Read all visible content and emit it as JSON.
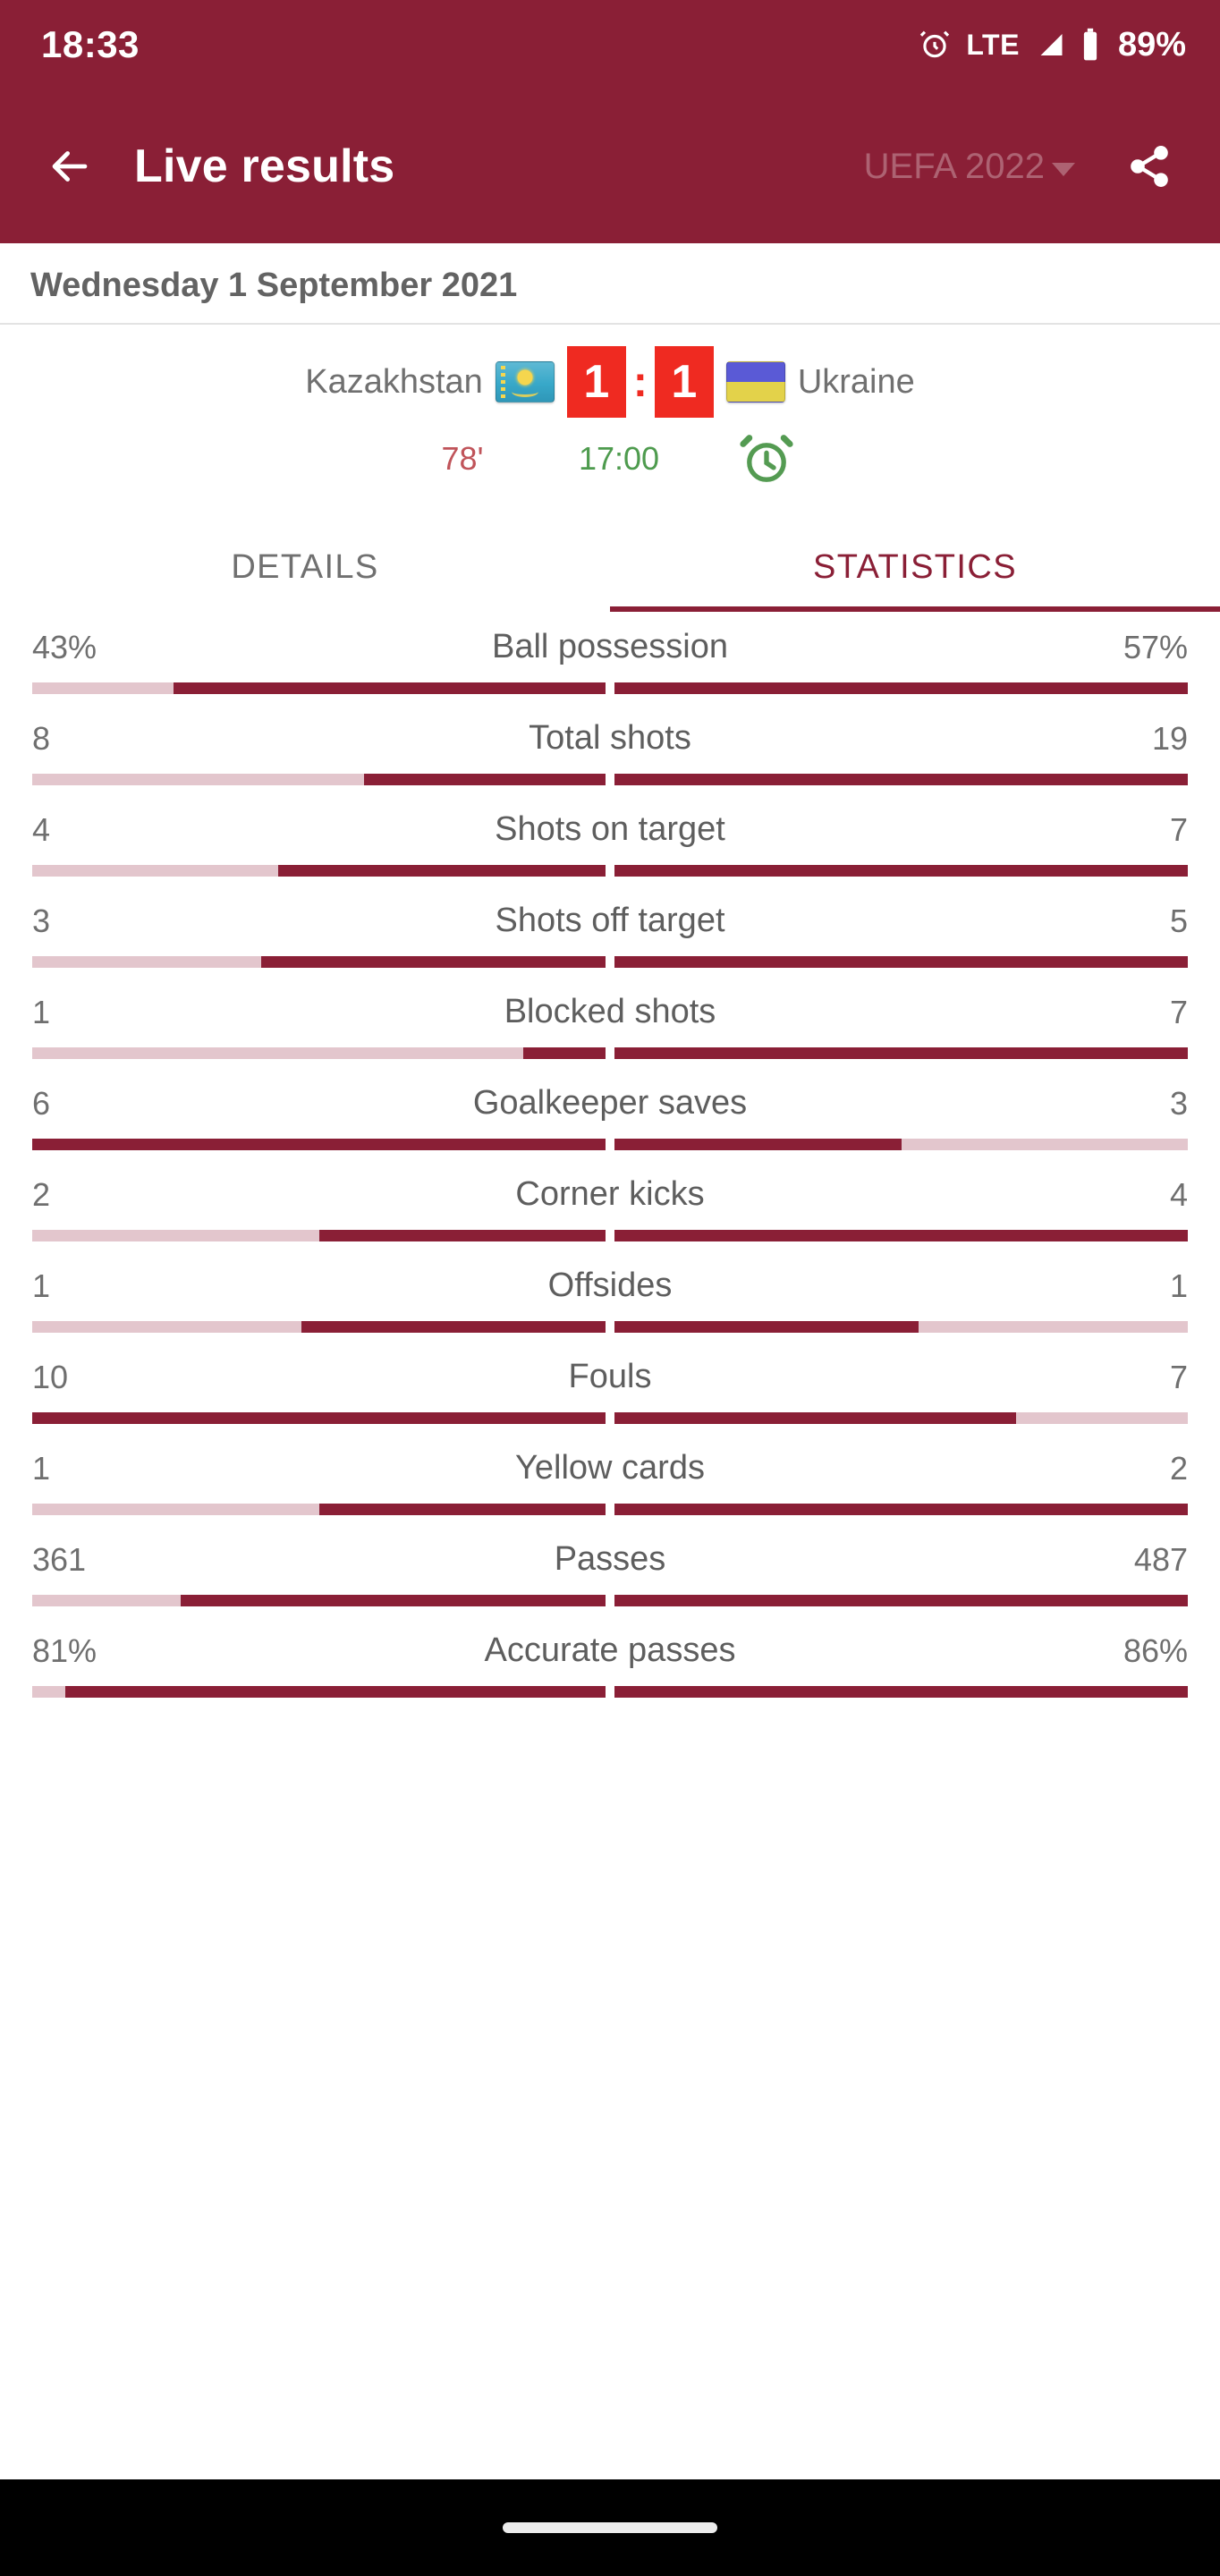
{
  "statusbar": {
    "time": "18:33",
    "network": "LTE",
    "battery": "89%",
    "alarm_icon": "alarm-clock-icon",
    "signal_icon": "signal-bars-icon",
    "battery_icon": "battery-icon"
  },
  "appbar": {
    "back_icon": "back-arrow-icon",
    "title": "Live results",
    "season": "UEFA 2022",
    "share_icon": "share-icon"
  },
  "date_header": "Wednesday 1 September 2021",
  "match": {
    "home_team": "Kazakhstan",
    "away_team": "Ukraine",
    "home_score": "1",
    "away_score": "1",
    "separator": ":",
    "minute": "78'",
    "kickoff": "17:00",
    "alarm_icon": "alarm-reminder-icon"
  },
  "tabs": [
    {
      "label": "DETAILS",
      "active": false
    },
    {
      "label": "STATISTICS",
      "active": true
    }
  ],
  "colors": {
    "brand": "#8a1f36",
    "score_badge": "#ef2a21",
    "bar_fill": "#8a1f36",
    "bar_track": "#e3c6cd",
    "minute": "#c0545a",
    "kickoff": "#4e9b4e"
  },
  "chart_data": {
    "type": "bar",
    "title": "Match statistics",
    "categories": [
      "Ball possession",
      "Total shots",
      "Shots on target",
      "Shots off target",
      "Blocked shots",
      "Goalkeeper saves",
      "Corner kicks",
      "Offsides",
      "Fouls",
      "Yellow cards",
      "Passes",
      "Accurate passes"
    ],
    "series": [
      {
        "name": "Kazakhstan",
        "values": [
          43,
          8,
          4,
          3,
          1,
          6,
          2,
          1,
          10,
          1,
          361,
          81
        ]
      },
      {
        "name": "Ukraine",
        "values": [
          57,
          19,
          7,
          5,
          7,
          3,
          4,
          1,
          7,
          2,
          487,
          86
        ]
      }
    ],
    "display_values": [
      {
        "left": "43%",
        "right": "57%"
      },
      {
        "left": "8",
        "right": "19"
      },
      {
        "left": "4",
        "right": "7"
      },
      {
        "left": "3",
        "right": "5"
      },
      {
        "left": "1",
        "right": "7"
      },
      {
        "left": "6",
        "right": "3"
      },
      {
        "left": "2",
        "right": "4"
      },
      {
        "left": "1",
        "right": "1"
      },
      {
        "left": "10",
        "right": "7"
      },
      {
        "left": "1",
        "right": "2"
      },
      {
        "left": "361",
        "right": "487"
      },
      {
        "left": "81%",
        "right": "86%"
      }
    ],
    "legend": [
      "Kazakhstan",
      "Ukraine"
    ],
    "legend_position": "none",
    "grid": false,
    "normalization": "each row scaled to max(left,right)"
  },
  "stats": [
    {
      "label": "Ball possession",
      "left": "43%",
      "right": "57%",
      "left_pct": 75.4,
      "right_pct": 100
    },
    {
      "label": "Total shots",
      "left": "8",
      "right": "19",
      "left_pct": 42.1,
      "right_pct": 100
    },
    {
      "label": "Shots on target",
      "left": "4",
      "right": "7",
      "left_pct": 57.1,
      "right_pct": 100
    },
    {
      "label": "Shots off target",
      "left": "3",
      "right": "5",
      "left_pct": 60.0,
      "right_pct": 100
    },
    {
      "label": "Blocked shots",
      "left": "1",
      "right": "7",
      "left_pct": 14.3,
      "right_pct": 100
    },
    {
      "label": "Goalkeeper saves",
      "left": "6",
      "right": "3",
      "left_pct": 100,
      "right_pct": 50.0
    },
    {
      "label": "Corner kicks",
      "left": "2",
      "right": "4",
      "left_pct": 50.0,
      "right_pct": 100
    },
    {
      "label": "Offsides",
      "left": "1",
      "right": "1",
      "left_pct": 53.0,
      "right_pct": 53.0
    },
    {
      "label": "Fouls",
      "left": "10",
      "right": "7",
      "left_pct": 100,
      "right_pct": 70.0
    },
    {
      "label": "Yellow cards",
      "left": "1",
      "right": "2",
      "left_pct": 50.0,
      "right_pct": 100
    },
    {
      "label": "Passes",
      "left": "361",
      "right": "487",
      "left_pct": 74.1,
      "right_pct": 100
    },
    {
      "label": "Accurate passes",
      "left": "81%",
      "right": "86%",
      "left_pct": 94.2,
      "right_pct": 100
    }
  ],
  "navbar": {
    "handle": "home-gesture-pill"
  }
}
